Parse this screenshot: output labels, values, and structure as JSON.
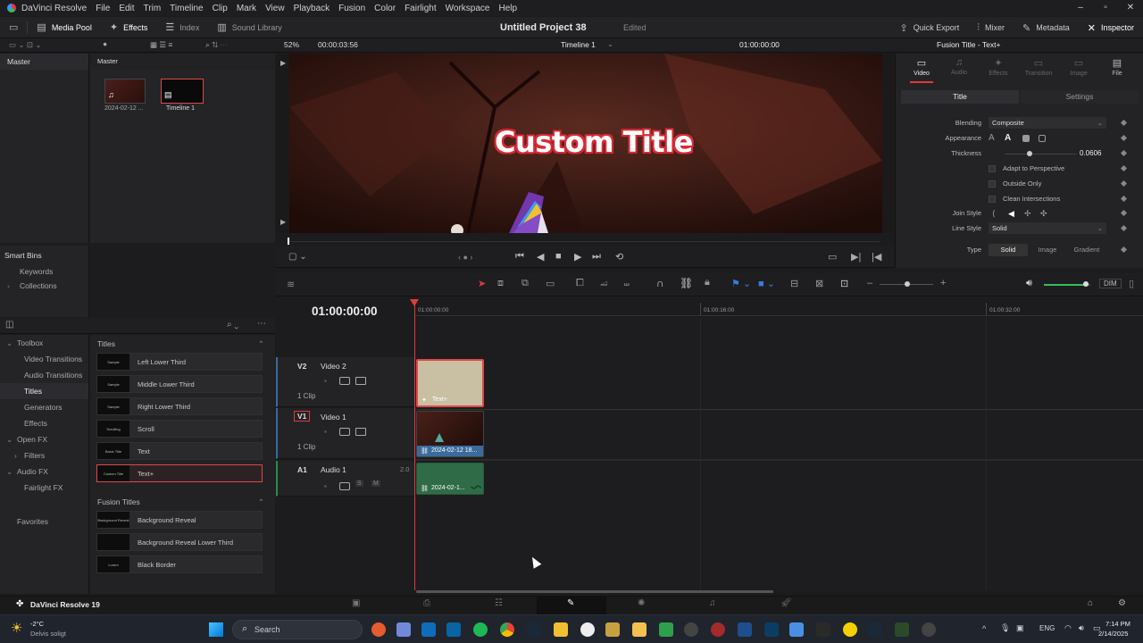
{
  "app": {
    "name": "DaVinci Resolve",
    "version_label": "DaVinci Resolve 19"
  },
  "menu": [
    "DaVinci Resolve",
    "File",
    "Edit",
    "Trim",
    "Timeline",
    "Clip",
    "Mark",
    "View",
    "Playback",
    "Fusion",
    "Color",
    "Fairlight",
    "Workspace",
    "Help"
  ],
  "toolbar": {
    "media_pool": "Media Pool",
    "effects": "Effects",
    "index": "Index",
    "sound_library": "Sound Library",
    "project_title": "Untitled Project 38",
    "project_status": "Edited",
    "quick_export": "Quick Export",
    "mixer": "Mixer",
    "metadata": "Metadata",
    "inspector": "Inspector"
  },
  "subbar": {
    "zoom": "52%",
    "timecode": "00:00:03:56",
    "timeline_name": "Timeline 1",
    "viewer_timecode": "01:00:00:00",
    "inspector_title": "Fusion Title - Text+"
  },
  "mediapool": {
    "left_header": "Master",
    "right_header": "Master",
    "clips": [
      {
        "label": "2024-02-12 ..."
      },
      {
        "label": "Timeline 1"
      }
    ]
  },
  "smart_bins": {
    "title": "Smart Bins",
    "items": [
      "Keywords",
      "Collections"
    ]
  },
  "effects_tree": {
    "items": [
      {
        "label": "Toolbox",
        "caret": "⌄",
        "indent": 0
      },
      {
        "label": "Video Transitions",
        "indent": 1
      },
      {
        "label": "Audio Transitions",
        "indent": 1
      },
      {
        "label": "Titles",
        "indent": 1,
        "selected": true
      },
      {
        "label": "Generators",
        "indent": 1
      },
      {
        "label": "Effects",
        "indent": 1
      },
      {
        "label": "Open FX",
        "caret": "⌄",
        "indent": 0
      },
      {
        "label": "Filters",
        "caret": "›",
        "indent": 1
      },
      {
        "label": "Audio FX",
        "caret": "⌄",
        "indent": 0
      },
      {
        "label": "Fairlight FX",
        "indent": 1
      }
    ],
    "favorites": "Favorites"
  },
  "effects_list": {
    "titles_header": "Titles",
    "titles": [
      {
        "label": "Left Lower Third",
        "thumb": "Sample"
      },
      {
        "label": "Middle Lower Third",
        "thumb": "Sample"
      },
      {
        "label": "Right Lower Third",
        "thumb": "Sample"
      },
      {
        "label": "Scroll",
        "thumb": "Scrolling"
      },
      {
        "label": "Text",
        "thumb": "Basic Title"
      },
      {
        "label": "Text+",
        "thumb": "Custom Title",
        "selected": true
      }
    ],
    "fusion_header": "Fusion Titles",
    "fusion_titles": [
      {
        "label": "Background Reveal",
        "thumb": "Background Reveal"
      },
      {
        "label": "Background Reveal Lower Third",
        "thumb": ""
      },
      {
        "label": "Black Border",
        "thumb": "Lorem"
      }
    ]
  },
  "viewer": {
    "title_text": "Custom Title"
  },
  "inspector": {
    "tabs": [
      "Video",
      "Audio",
      "Effects",
      "Transition",
      "Image",
      "File"
    ],
    "subtabs": [
      "Title",
      "Settings"
    ],
    "blending_label": "Blending",
    "blending_value": "Composite",
    "appearance_label": "Appearance",
    "thickness_label": "Thickness",
    "thickness_value": "0.0606",
    "thickness_level": 0.35,
    "checks": [
      "Adapt to Perspective",
      "Outside Only",
      "Clean Intersections"
    ],
    "join_style_label": "Join Style",
    "line_style_label": "Line Style",
    "line_style_value": "Solid",
    "type_label": "Type",
    "type_options": [
      "Solid",
      "Image",
      "Gradient"
    ]
  },
  "timeline": {
    "current_timecode": "01:00:00:00",
    "ruler": [
      "01:00:00:00",
      "01:00:16:00",
      "01:00:32:00"
    ],
    "tracks": [
      {
        "id": "V2",
        "name": "Video 2",
        "clips": "1 Clip"
      },
      {
        "id": "V1",
        "name": "Video 1",
        "clips": "1 Clip"
      },
      {
        "id": "A1",
        "name": "Audio 1",
        "channels": "2.0"
      }
    ],
    "clip_text": "Text+",
    "clip_video": "2024-02-12 18...",
    "clip_audio": "2024-02-1...",
    "dim": "DIM",
    "volume_level": 0.9
  },
  "taskbar": {
    "weather_temp": "-2°C",
    "weather_desc": "Delvis soligt",
    "search": "Search",
    "lang": "ENG",
    "time": "7:14 PM",
    "date": "2/14/2025"
  },
  "colors": {
    "accent_red": "#e03a3a",
    "clip_text": "#c9bfa3",
    "clip_audio": "#2f6b47",
    "clip_video_label": "#3a6b9c"
  }
}
